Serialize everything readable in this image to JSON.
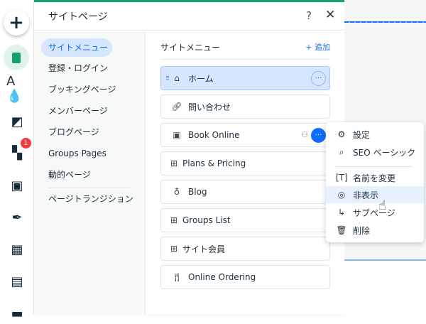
{
  "rail": {
    "badge_count": "1",
    "icons": [
      "add-icon",
      "pages-icon",
      "theme-icon",
      "background-icon",
      "apps-icon",
      "media-icon",
      "blog-icon",
      "bookings-icon",
      "table-icon",
      "business-icon"
    ]
  },
  "panel": {
    "title": "サイトページ",
    "help": "?",
    "close": "✕"
  },
  "nav": {
    "items": [
      "サイトメニュー",
      "登録・ログイン",
      "ブッキングページ",
      "メンバーページ",
      "ブログページ",
      "Groups Pages",
      "動的ページ"
    ],
    "transition": "ページトランジション"
  },
  "main": {
    "title": "サイトメニュー",
    "add": "+ 追加",
    "pages": [
      {
        "label": "ホーム",
        "icon": "home-icon"
      },
      {
        "label": "問い合わせ",
        "icon": "link-icon"
      },
      {
        "label": "Book Online",
        "icon": "calendar-icon"
      },
      {
        "label": "Plans & Pricing",
        "icon": "app-icon"
      },
      {
        "label": "Blog",
        "icon": "pen-icon"
      },
      {
        "label": "Groups List",
        "icon": "app-icon"
      },
      {
        "label": "サイト会員",
        "icon": "app-icon"
      },
      {
        "label": "Online Ordering",
        "icon": "fork-knife-icon"
      }
    ]
  },
  "menu": {
    "items": [
      "設定",
      "SEO ベーシック",
      "名前を変更",
      "非表示",
      "サブページ",
      "削除"
    ]
  },
  "colors": {
    "accent": "#116dff",
    "green": "#11a36b"
  }
}
